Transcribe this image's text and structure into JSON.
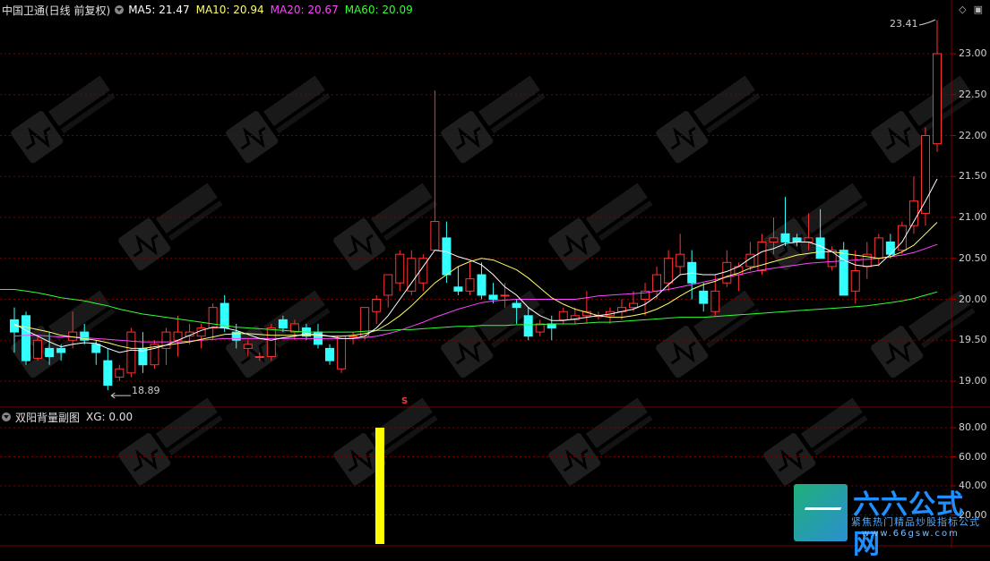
{
  "main_panel": {
    "title": "中国卫通(日线 前复权)",
    "indicators": [
      {
        "label": "MA5: 21.47",
        "color": "#ffffff"
      },
      {
        "label": "MA10: 20.94",
        "color": "#ffff66"
      },
      {
        "label": "MA20: 20.67",
        "color": "#ff44ff"
      },
      {
        "label": "MA60: 20.09",
        "color": "#33ff33"
      }
    ],
    "price_ticks": [
      "23.00",
      "22.50",
      "22.00",
      "21.50",
      "21.00",
      "20.50",
      "20.00",
      "19.50",
      "19.00"
    ],
    "high_annotation": "23.41",
    "low_annotation": "18.89",
    "signal_marker": "S"
  },
  "sub_panel": {
    "title": "双阳背量副图",
    "value_label": "XG: 0.00",
    "ticks": [
      "80.00",
      "60.00",
      "40.00",
      "20.00"
    ],
    "signal_bar_value": 80
  },
  "watermark": {
    "brand": "六六公式网",
    "tagline": "紧焦热门精品炒股指标公式",
    "url": "www.66gsw.com"
  },
  "colors": {
    "up": "#ff3333",
    "down": "#33ffff",
    "grid": "#7a0000",
    "signal_bar": "#ffff00"
  },
  "chart_data": {
    "type": "candlestick",
    "series_ohlc": [
      [
        19.75,
        19.9,
        19.35,
        19.6
      ],
      [
        19.8,
        19.85,
        19.2,
        19.25
      ],
      [
        19.28,
        19.55,
        19.25,
        19.5
      ],
      [
        19.4,
        19.6,
        19.2,
        19.3
      ],
      [
        19.4,
        19.45,
        19.25,
        19.35
      ],
      [
        19.5,
        19.85,
        19.4,
        19.6
      ],
      [
        19.6,
        19.7,
        19.45,
        19.5
      ],
      [
        19.45,
        19.5,
        19.2,
        19.35
      ],
      [
        19.25,
        19.4,
        18.89,
        18.95
      ],
      [
        19.05,
        19.2,
        19.0,
        19.15
      ],
      [
        19.1,
        19.65,
        19.05,
        19.6
      ],
      [
        19.4,
        19.6,
        19.1,
        19.2
      ],
      [
        19.2,
        19.5,
        19.15,
        19.45
      ],
      [
        19.4,
        19.65,
        19.2,
        19.6
      ],
      [
        19.5,
        19.8,
        19.3,
        19.6
      ],
      [
        19.55,
        19.7,
        19.45,
        19.6
      ],
      [
        19.55,
        19.7,
        19.4,
        19.65
      ],
      [
        19.65,
        19.95,
        19.5,
        19.9
      ],
      [
        19.95,
        20.05,
        19.6,
        19.65
      ],
      [
        19.6,
        19.7,
        19.4,
        19.5
      ],
      [
        19.4,
        19.5,
        19.3,
        19.45
      ],
      [
        19.3,
        19.35,
        19.25,
        19.3
      ],
      [
        19.3,
        19.7,
        19.25,
        19.65
      ],
      [
        19.75,
        19.8,
        19.6,
        19.65
      ],
      [
        19.6,
        19.75,
        19.5,
        19.7
      ],
      [
        19.65,
        19.7,
        19.5,
        19.55
      ],
      [
        19.6,
        19.7,
        19.4,
        19.45
      ],
      [
        19.4,
        19.45,
        19.2,
        19.25
      ],
      [
        19.15,
        19.55,
        19.1,
        19.55
      ],
      [
        19.55,
        19.6,
        19.45,
        19.55
      ],
      [
        19.55,
        19.9,
        19.5,
        19.9
      ],
      [
        19.85,
        20.05,
        19.7,
        20.0
      ],
      [
        20.05,
        20.3,
        19.9,
        20.3
      ],
      [
        20.2,
        20.6,
        20.1,
        20.55
      ],
      [
        20.1,
        20.6,
        20.05,
        20.5
      ],
      [
        20.2,
        20.55,
        20.1,
        20.5
      ],
      [
        20.6,
        22.55,
        20.6,
        20.95
      ],
      [
        20.75,
        20.95,
        20.2,
        20.3
      ],
      [
        20.15,
        20.4,
        20.05,
        20.1
      ],
      [
        20.1,
        20.45,
        20.05,
        20.25
      ],
      [
        20.3,
        20.45,
        20.0,
        20.05
      ],
      [
        20.05,
        20.2,
        19.95,
        20.0
      ],
      [
        20.05,
        20.2,
        19.9,
        20.05
      ],
      [
        19.95,
        20.0,
        19.7,
        19.9
      ],
      [
        19.8,
        19.9,
        19.5,
        19.55
      ],
      [
        19.6,
        19.75,
        19.55,
        19.7
      ],
      [
        19.7,
        19.8,
        19.5,
        19.65
      ],
      [
        19.75,
        19.9,
        19.7,
        19.85
      ],
      [
        19.75,
        19.9,
        19.7,
        19.8
      ],
      [
        19.8,
        20.1,
        19.7,
        19.85
      ],
      [
        19.8,
        19.85,
        19.75,
        19.8
      ],
      [
        19.8,
        19.9,
        19.7,
        19.85
      ],
      [
        19.85,
        20.0,
        19.75,
        19.9
      ],
      [
        19.9,
        20.1,
        19.85,
        19.95
      ],
      [
        20.0,
        20.2,
        19.8,
        20.1
      ],
      [
        20.1,
        20.4,
        20.0,
        20.3
      ],
      [
        20.2,
        20.6,
        20.1,
        20.5
      ],
      [
        20.4,
        20.8,
        20.3,
        20.55
      ],
      [
        20.45,
        20.6,
        20.0,
        20.2
      ],
      [
        20.1,
        20.2,
        19.85,
        19.95
      ],
      [
        19.85,
        20.3,
        19.8,
        20.1
      ],
      [
        20.2,
        20.6,
        20.15,
        20.45
      ],
      [
        20.3,
        20.45,
        20.1,
        20.4
      ],
      [
        20.4,
        20.7,
        20.35,
        20.55
      ],
      [
        20.35,
        20.8,
        20.3,
        20.7
      ],
      [
        20.7,
        21.0,
        20.55,
        20.75
      ],
      [
        20.8,
        21.25,
        20.65,
        20.7
      ],
      [
        20.75,
        20.8,
        20.65,
        20.7
      ],
      [
        20.7,
        21.05,
        20.6,
        20.75
      ],
      [
        20.75,
        21.1,
        20.55,
        20.5
      ],
      [
        20.4,
        20.65,
        20.35,
        20.6
      ],
      [
        20.6,
        20.7,
        20.1,
        20.05
      ],
      [
        20.1,
        20.6,
        19.95,
        20.35
      ],
      [
        20.4,
        20.7,
        20.25,
        20.55
      ],
      [
        20.5,
        20.8,
        20.4,
        20.75
      ],
      [
        20.7,
        20.8,
        20.5,
        20.55
      ],
      [
        20.6,
        20.95,
        20.55,
        20.9
      ],
      [
        20.9,
        21.5,
        20.8,
        21.2
      ],
      [
        21.05,
        22.1,
        20.9,
        22.0
      ],
      [
        21.9,
        23.41,
        21.8,
        23.0
      ]
    ],
    "ma5": [
      19.7,
      19.62,
      19.55,
      19.48,
      19.42,
      19.45,
      19.47,
      19.46,
      19.4,
      19.35,
      19.38,
      19.37,
      19.4,
      19.44,
      19.5,
      19.56,
      19.62,
      19.66,
      19.65,
      19.62,
      19.57,
      19.52,
      19.5,
      19.53,
      19.55,
      19.58,
      19.57,
      19.55,
      19.52,
      19.52,
      19.55,
      19.65,
      19.8,
      20.0,
      20.2,
      20.4,
      20.6,
      20.58,
      20.52,
      20.48,
      20.42,
      20.3,
      20.15,
      20.05,
      19.9,
      19.8,
      19.74,
      19.74,
      19.76,
      19.78,
      19.8,
      19.82,
      19.85,
      19.88,
      19.94,
      20.04,
      20.18,
      20.3,
      20.32,
      20.3,
      20.3,
      20.34,
      20.4,
      20.5,
      20.58,
      20.62,
      20.68,
      20.7,
      20.7,
      20.65,
      20.58,
      20.48,
      20.42,
      20.4,
      20.42,
      20.55,
      20.7,
      20.95,
      21.2,
      21.47
    ],
    "ma10": [
      19.68,
      19.66,
      19.63,
      19.6,
      19.56,
      19.54,
      19.52,
      19.5,
      19.47,
      19.43,
      19.4,
      19.4,
      19.42,
      19.44,
      19.46,
      19.48,
      19.51,
      19.54,
      19.57,
      19.58,
      19.58,
      19.57,
      19.56,
      19.56,
      19.56,
      19.56,
      19.56,
      19.55,
      19.55,
      19.56,
      19.58,
      19.62,
      19.7,
      19.8,
      19.92,
      20.06,
      20.2,
      20.3,
      20.4,
      20.46,
      20.5,
      20.48,
      20.42,
      20.36,
      20.26,
      20.14,
      20.02,
      19.94,
      19.88,
      19.84,
      19.8,
      19.78,
      19.78,
      19.8,
      19.83,
      19.88,
      19.95,
      20.04,
      20.12,
      20.18,
      20.22,
      20.28,
      20.32,
      20.38,
      20.42,
      20.46,
      20.5,
      20.54,
      20.56,
      20.58,
      20.58,
      20.56,
      20.54,
      20.52,
      20.5,
      20.52,
      20.58,
      20.66,
      20.8,
      20.94
    ],
    "ma20": [
      19.55,
      19.56,
      19.56,
      19.55,
      19.54,
      19.54,
      19.53,
      19.52,
      19.51,
      19.5,
      19.49,
      19.48,
      19.48,
      19.48,
      19.48,
      19.49,
      19.5,
      19.51,
      19.52,
      19.52,
      19.52,
      19.52,
      19.52,
      19.52,
      19.52,
      19.52,
      19.52,
      19.52,
      19.52,
      19.52,
      19.53,
      19.55,
      19.58,
      19.62,
      19.67,
      19.72,
      19.78,
      19.83,
      19.88,
      19.92,
      19.96,
      19.98,
      19.99,
      20.0,
      20.0,
      20.0,
      20.0,
      20.0,
      20.0,
      20.02,
      20.04,
      20.05,
      20.06,
      20.07,
      20.08,
      20.1,
      20.12,
      20.15,
      20.18,
      20.21,
      20.24,
      20.27,
      20.3,
      20.33,
      20.36,
      20.38,
      20.4,
      20.42,
      20.44,
      20.45,
      20.46,
      20.47,
      20.48,
      20.49,
      20.5,
      20.52,
      20.54,
      20.57,
      20.62,
      20.67
    ],
    "ma60": [
      20.12,
      20.1,
      20.08,
      20.05,
      20.02,
      20.0,
      19.98,
      19.95,
      19.92,
      19.88,
      19.85,
      19.82,
      19.8,
      19.78,
      19.76,
      19.74,
      19.72,
      19.7,
      19.68,
      19.66,
      19.65,
      19.64,
      19.63,
      19.62,
      19.61,
      19.6,
      19.6,
      19.6,
      19.6,
      19.6,
      19.61,
      19.62,
      19.62,
      19.63,
      19.63,
      19.64,
      19.65,
      19.66,
      19.67,
      19.67,
      19.68,
      19.68,
      19.68,
      19.69,
      19.69,
      19.69,
      19.7,
      19.7,
      19.7,
      19.71,
      19.72,
      19.72,
      19.73,
      19.74,
      19.75,
      19.76,
      19.77,
      19.78,
      19.78,
      19.78,
      19.79,
      19.8,
      19.81,
      19.82,
      19.83,
      19.84,
      19.85,
      19.86,
      19.87,
      19.88,
      19.89,
      19.9,
      19.91,
      19.92,
      19.94,
      19.96,
      19.98,
      20.01,
      20.05,
      20.09
    ],
    "price_range": [
      18.8,
      23.5
    ],
    "sub_range": [
      0,
      90
    ]
  }
}
